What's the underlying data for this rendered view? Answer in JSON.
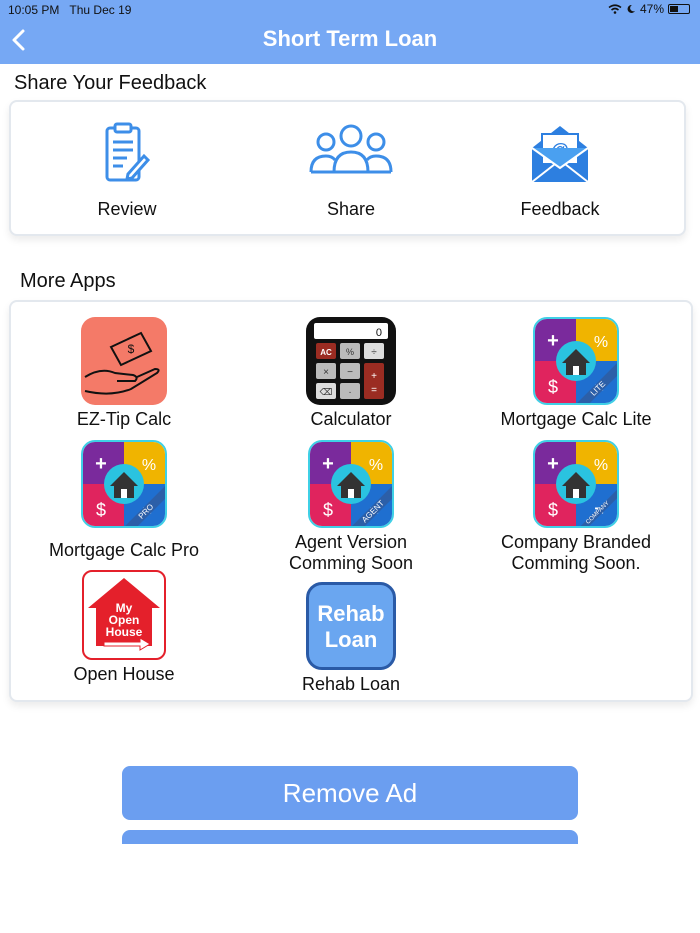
{
  "status_bar": {
    "time": "10:05 PM",
    "date": "Thu Dec 19",
    "battery": "47%",
    "battery_level": 0.47
  },
  "header": {
    "title": "Short Term Loan",
    "back_icon": "chevron-left-icon"
  },
  "feedback": {
    "title": "Share Your Feedback",
    "items": [
      {
        "label": "Review",
        "icon": "clipboard-icon"
      },
      {
        "label": "Share",
        "icon": "people-icon"
      },
      {
        "label": "Feedback",
        "icon": "email-icon"
      }
    ]
  },
  "more_apps": {
    "title": "More Apps",
    "apps": [
      {
        "label": "EZ-Tip Calc",
        "icon": "tip-hand-icon"
      },
      {
        "label": "Calculator",
        "icon": "calculator-icon",
        "display": "0",
        "keys": [
          "AC",
          "%",
          "÷",
          "×",
          "−",
          "+",
          "⌫",
          "·",
          "="
        ]
      },
      {
        "label": "Mortgage Calc Lite",
        "icon": "mortgage-house-icon",
        "ribbon": "LITE"
      },
      {
        "label": "Mortgage Calc Pro",
        "icon": "mortgage-house-icon",
        "ribbon": "PRO"
      },
      {
        "label": "Agent Version\nComming Soon",
        "icon": "mortgage-house-icon",
        "ribbon": "AGENT"
      },
      {
        "label": "Company Branded\nComming Soon.",
        "icon": "mortgage-house-icon",
        "ribbon": "COMPANY"
      },
      {
        "label": "Open House",
        "icon": "open-house-icon",
        "line1": "My",
        "line2": "Open",
        "line3": "House"
      },
      {
        "label": "Rehab Loan",
        "icon": "rehab-loan-icon",
        "line1": "Rehab",
        "line2": "Loan"
      }
    ],
    "symbols": {
      "plus": "+",
      "percent": "%",
      "dollar": "$",
      "equals": "="
    }
  },
  "buttons": {
    "remove_ad": "Remove Ad"
  },
  "colors": {
    "header": "#76a8f4",
    "icon_blue": "#3d8ee8",
    "button": "#6b9ef0",
    "tip_bg": "#f47a68",
    "rehab_bg": "#6aa6f0",
    "house_red": "#e4202b"
  }
}
